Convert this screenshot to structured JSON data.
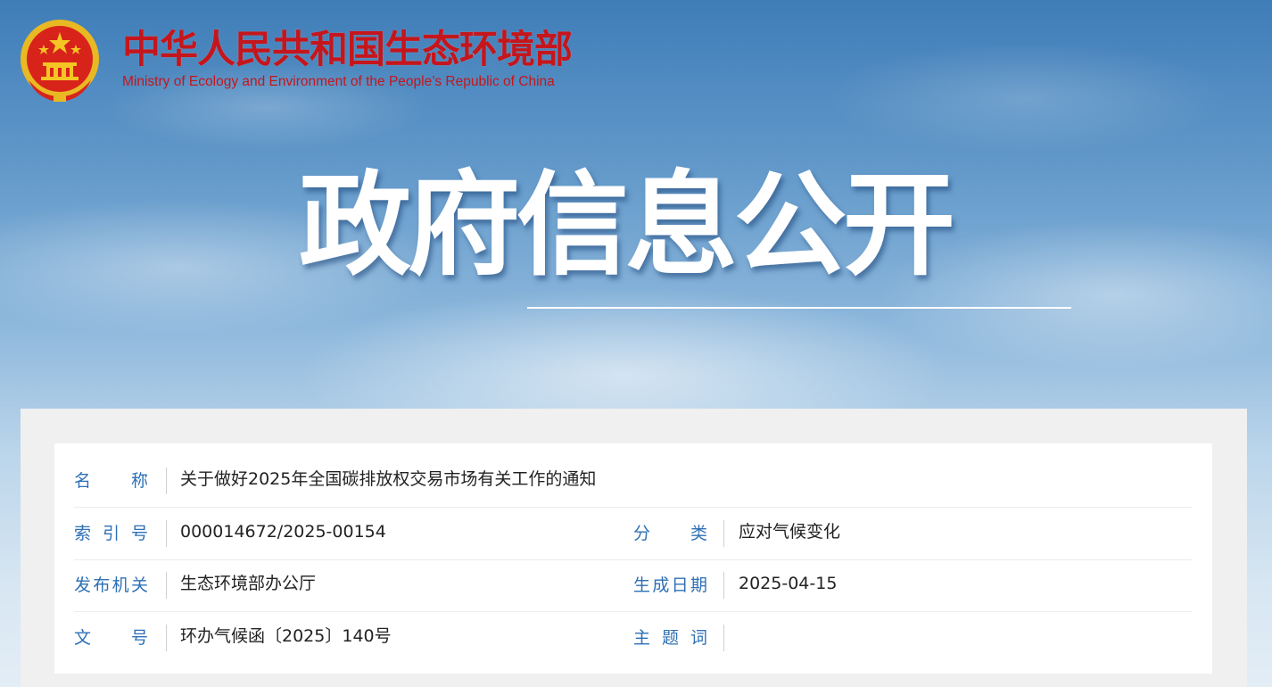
{
  "header": {
    "ministry_cn": "中华人民共和国生态环境部",
    "ministry_en": "Ministry of Ecology and Environment of the People’s Republic of China",
    "emblem_icon": "national-emblem-icon",
    "hero_title": "政府信息公开"
  },
  "colors": {
    "brand_red": "#c4161c",
    "label_blue": "#2e70b5",
    "sky_top": "#3f7db8",
    "sky_bottom": "#e3edf6"
  },
  "info": {
    "name_label": "名　　称",
    "name_value": "关于做好2025年全国碳排放权交易市场有关工作的通知",
    "index_label": "索引号",
    "index_value": "000014672/2025-00154",
    "category_label": "分　　类",
    "category_value": "应对气候变化",
    "publisher_label": "发布机关",
    "publisher_value": "生态环境部办公厅",
    "date_label": "生成日期",
    "date_value": "2025-04-15",
    "docno_label": "文　　号",
    "docno_value": "环办气候函〔2025〕140号",
    "subject_label": "主题词",
    "subject_value": ""
  }
}
